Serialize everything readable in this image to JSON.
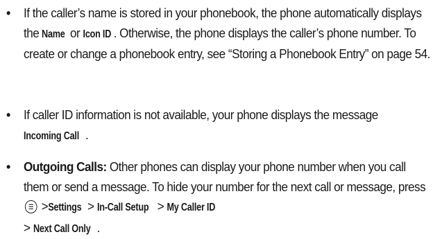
{
  "bullet_char": "•",
  "item1": {
    "t1": "If the caller’s name is stored in your phonebook, the phone automatically displays the ",
    "name_label": "Name",
    "t2": " or ",
    "icon_label": "Icon ID",
    "t3": ". Otherwise, the phone displays the caller’s phone number. To create or change a phonebook entry, see “Storing a Phonebook Entry” on page 54."
  },
  "item2": {
    "t1": "If caller ID information is not available, your phone displays the message ",
    "message_label": "Incoming Call",
    "t2": "."
  },
  "item3": {
    "heading": "Outgoing Calls:",
    "t1": " Other phones can display your phone number when you call them or send a message. To hide your number for the next call or message, press ",
    "sep1": " >",
    "settings_label": "Settings",
    "sep2": " > ",
    "in_call_setup_label": "In-Call Setup",
    "sep3": " > ",
    "my_caller_id_label": "My Caller ID",
    "sep4": " > ",
    "next_call_only_label": "Next Call Only",
    "t2": "."
  },
  "icons": {
    "menu_key": "menu-key-icon"
  }
}
